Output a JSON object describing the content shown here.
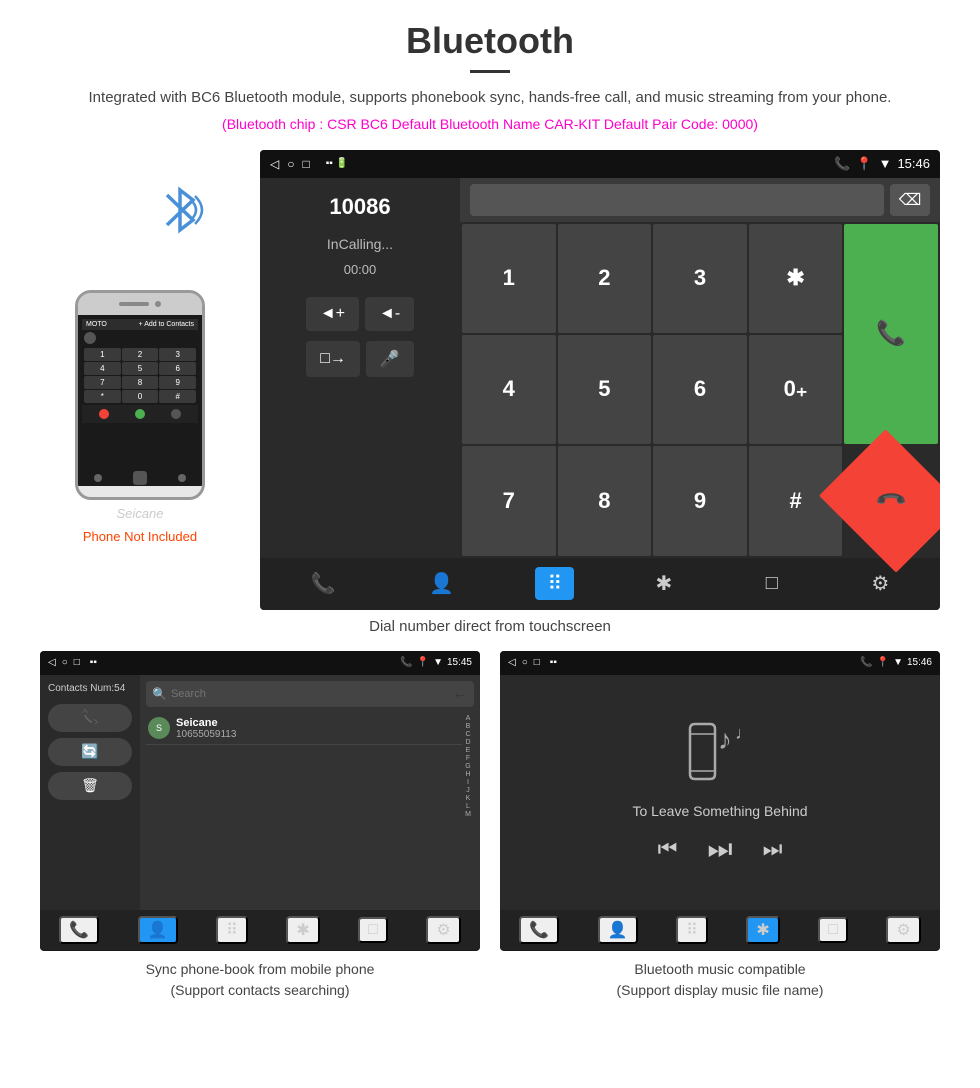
{
  "page": {
    "title": "Bluetooth",
    "subtitle": "Integrated with BC6 Bluetooth module, supports phonebook sync, hands-free call, and music streaming from your phone.",
    "specs": "(Bluetooth chip : CSR BC6    Default Bluetooth Name CAR-KIT    Default Pair Code: 0000)",
    "main_caption": "Dial number direct from touchscreen",
    "phone_not_included": "Phone Not Included"
  },
  "car_screen": {
    "status_bar": {
      "left_icons": [
        "◁",
        "○",
        "□"
      ],
      "right_icons": [
        "📞",
        "📍",
        "▼"
      ],
      "time": "15:46"
    },
    "number": "10086",
    "calling_text": "InCalling...",
    "timer": "00:00",
    "vol_up": "◄+",
    "vol_down": "◄-",
    "transfer": "□→",
    "mic": "🎤",
    "backspace_icon": "⌫",
    "numpad": [
      "1",
      "2",
      "3",
      "*",
      "4",
      "5",
      "6",
      "0+",
      "7",
      "8",
      "9",
      "#"
    ],
    "call_btn": "📞",
    "hang_btn": "📞",
    "bottom_buttons": [
      "📞",
      "👤",
      "⠿",
      "✱",
      "□",
      "⚙"
    ]
  },
  "phonebook_screen": {
    "status_bar_time": "15:45",
    "contacts_num": "Contacts Num:54",
    "contact": {
      "name": "Seicane",
      "number": "10655059113"
    },
    "search_placeholder": "Search",
    "alphabet": [
      "A",
      "B",
      "C",
      "D",
      "E",
      "F",
      "G",
      "H",
      "I",
      "J",
      "K",
      "L",
      "M"
    ],
    "back_icon": "←",
    "bottom_buttons": [
      "📞",
      "👤",
      "⠿",
      "✱",
      "□",
      "⚙"
    ]
  },
  "music_screen": {
    "status_bar_time": "15:46",
    "song_title": "To Leave Something Behind",
    "prev_icon": "⏮",
    "play_pause_icon": "⏭",
    "next_icon": "⏭",
    "bottom_buttons": [
      "📞",
      "👤",
      "⠿",
      "✱",
      "□",
      "⚙"
    ]
  },
  "bottom_captions": {
    "phonebook": "Sync phone-book from mobile phone\n(Support contacts searching)",
    "music": "Bluetooth music compatible\n(Support display music file name)"
  }
}
